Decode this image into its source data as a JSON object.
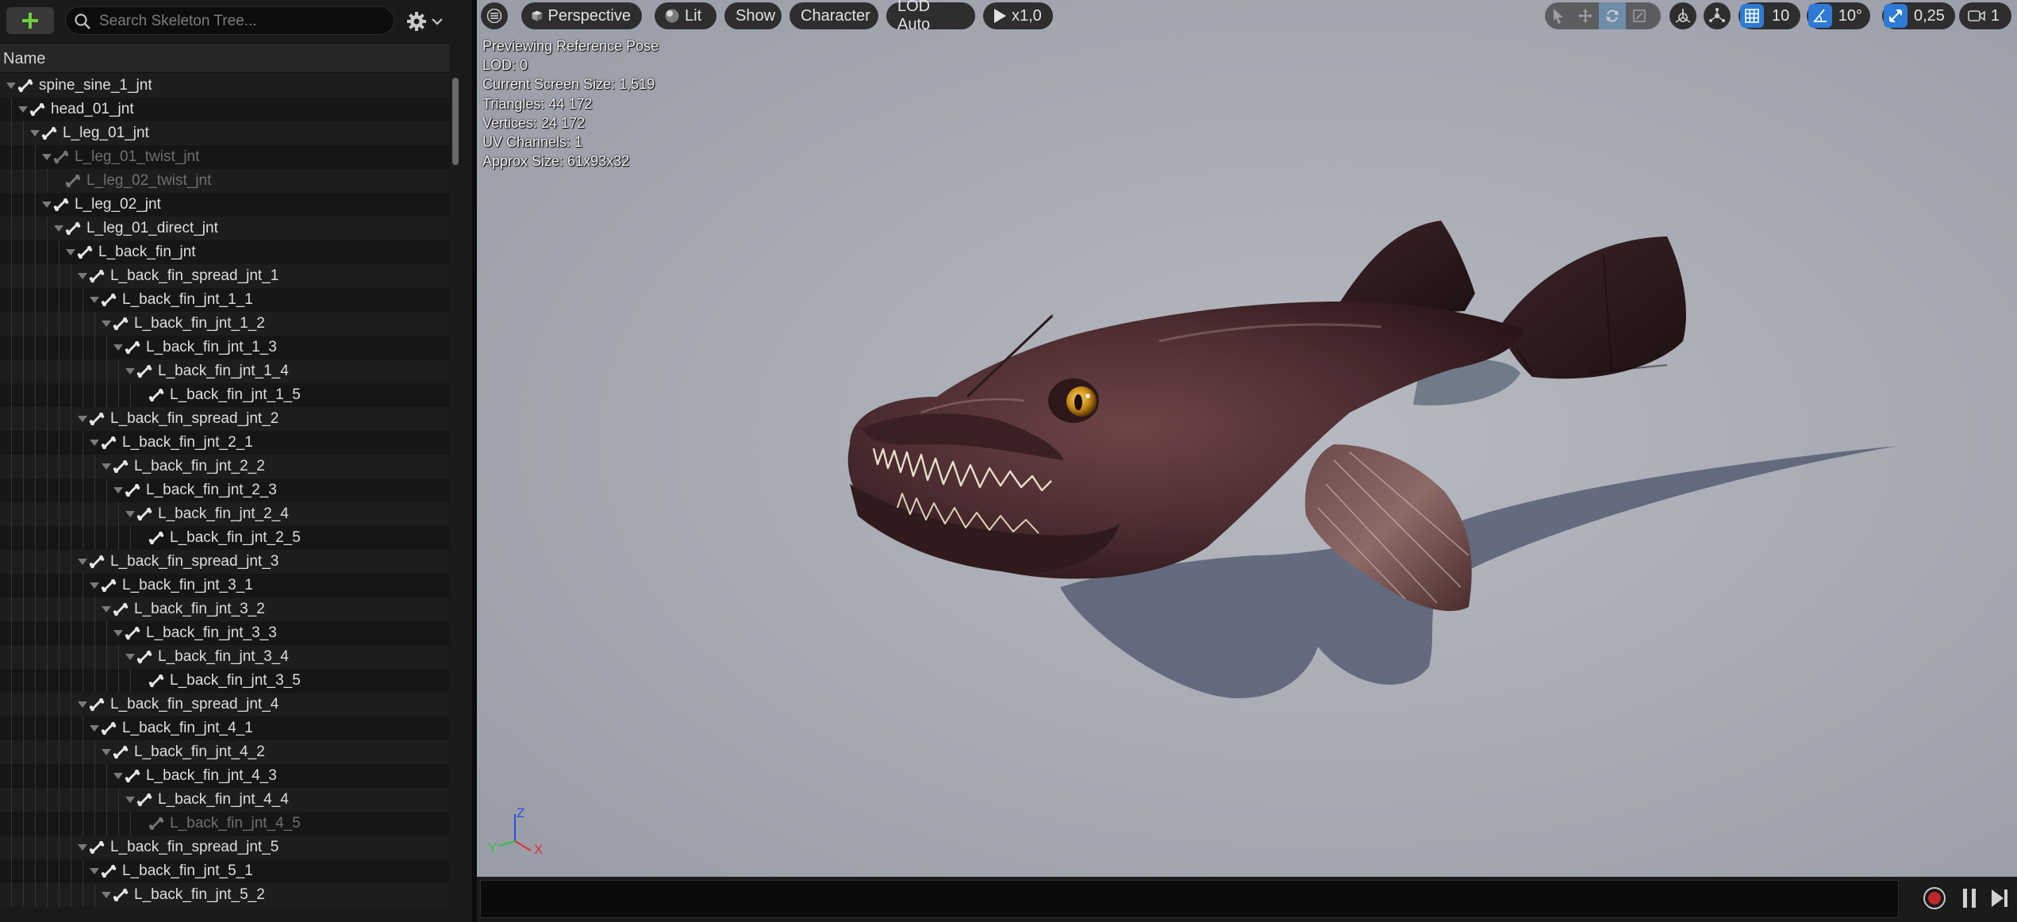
{
  "skeleton": {
    "search_placeholder": "Search Skeleton Tree...",
    "column_header": "Name",
    "rows": [
      {
        "label": "spine_sine_1_jnt",
        "depth": 0,
        "arrow": true,
        "dim": false
      },
      {
        "label": "head_01_jnt",
        "depth": 1,
        "arrow": true,
        "dim": false
      },
      {
        "label": "L_leg_01_jnt",
        "depth": 2,
        "arrow": true,
        "dim": false
      },
      {
        "label": "L_leg_01_twist_jnt",
        "depth": 3,
        "arrow": true,
        "dim": true
      },
      {
        "label": "L_leg_02_twist_jnt",
        "depth": 4,
        "arrow": false,
        "dim": true
      },
      {
        "label": "L_leg_02_jnt",
        "depth": 3,
        "arrow": true,
        "dim": false
      },
      {
        "label": "L_leg_01_direct_jnt",
        "depth": 4,
        "arrow": true,
        "dim": false
      },
      {
        "label": "L_back_fin_jnt",
        "depth": 5,
        "arrow": true,
        "dim": false
      },
      {
        "label": "L_back_fin_spread_jnt_1",
        "depth": 6,
        "arrow": true,
        "dim": false
      },
      {
        "label": "L_back_fin_jnt_1_1",
        "depth": 7,
        "arrow": true,
        "dim": false
      },
      {
        "label": "L_back_fin_jnt_1_2",
        "depth": 8,
        "arrow": true,
        "dim": false
      },
      {
        "label": "L_back_fin_jnt_1_3",
        "depth": 9,
        "arrow": true,
        "dim": false
      },
      {
        "label": "L_back_fin_jnt_1_4",
        "depth": 10,
        "arrow": true,
        "dim": false
      },
      {
        "label": "L_back_fin_jnt_1_5",
        "depth": 11,
        "arrow": false,
        "dim": false
      },
      {
        "label": "L_back_fin_spread_jnt_2",
        "depth": 6,
        "arrow": true,
        "dim": false
      },
      {
        "label": "L_back_fin_jnt_2_1",
        "depth": 7,
        "arrow": true,
        "dim": false
      },
      {
        "label": "L_back_fin_jnt_2_2",
        "depth": 8,
        "arrow": true,
        "dim": false
      },
      {
        "label": "L_back_fin_jnt_2_3",
        "depth": 9,
        "arrow": true,
        "dim": false
      },
      {
        "label": "L_back_fin_jnt_2_4",
        "depth": 10,
        "arrow": true,
        "dim": false
      },
      {
        "label": "L_back_fin_jnt_2_5",
        "depth": 11,
        "arrow": false,
        "dim": false
      },
      {
        "label": "L_back_fin_spread_jnt_3",
        "depth": 6,
        "arrow": true,
        "dim": false
      },
      {
        "label": "L_back_fin_jnt_3_1",
        "depth": 7,
        "arrow": true,
        "dim": false
      },
      {
        "label": "L_back_fin_jnt_3_2",
        "depth": 8,
        "arrow": true,
        "dim": false
      },
      {
        "label": "L_back_fin_jnt_3_3",
        "depth": 9,
        "arrow": true,
        "dim": false
      },
      {
        "label": "L_back_fin_jnt_3_4",
        "depth": 10,
        "arrow": true,
        "dim": false
      },
      {
        "label": "L_back_fin_jnt_3_5",
        "depth": 11,
        "arrow": false,
        "dim": false
      },
      {
        "label": "L_back_fin_spread_jnt_4",
        "depth": 6,
        "arrow": true,
        "dim": false
      },
      {
        "label": "L_back_fin_jnt_4_1",
        "depth": 7,
        "arrow": true,
        "dim": false
      },
      {
        "label": "L_back_fin_jnt_4_2",
        "depth": 8,
        "arrow": true,
        "dim": false
      },
      {
        "label": "L_back_fin_jnt_4_3",
        "depth": 9,
        "arrow": true,
        "dim": false
      },
      {
        "label": "L_back_fin_jnt_4_4",
        "depth": 10,
        "arrow": true,
        "dim": false
      },
      {
        "label": "L_back_fin_jnt_4_5",
        "depth": 11,
        "arrow": false,
        "dim": true
      },
      {
        "label": "L_back_fin_spread_jnt_5",
        "depth": 6,
        "arrow": true,
        "dim": false
      },
      {
        "label": "L_back_fin_jnt_5_1",
        "depth": 7,
        "arrow": true,
        "dim": false
      },
      {
        "label": "L_back_fin_jnt_5_2",
        "depth": 8,
        "arrow": true,
        "dim": false
      }
    ]
  },
  "viewport": {
    "menu_icon": "hamburger-icon",
    "perspective": "Perspective",
    "lit": "Lit",
    "show": "Show",
    "character": "Character",
    "lod": "LOD Auto",
    "play_speed": "x1,0",
    "grid_snap": "10",
    "rotation_snap": "10°",
    "scale_snap": "0,25",
    "camera_speed": "1",
    "stats": [
      "Previewing Reference Pose",
      "LOD: 0",
      "Current Screen Size: 1,519",
      "Triangles: 44 172",
      "Vertices: 24 172",
      "UV Channels: 1",
      "Approx Size: 61x93x32"
    ],
    "axis": {
      "z": "Z",
      "y": "Y",
      "x": "X"
    },
    "colors": {
      "accent": "#2e7ad6",
      "background": "#a7aab3",
      "record": "#c0282a"
    }
  }
}
